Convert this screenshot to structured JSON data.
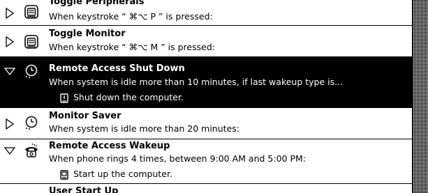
{
  "items": [
    {
      "title": "Toggle Peripherals",
      "condition": "When keystroke “ ⌘⌥ P ” is pressed:",
      "expanded": false,
      "selected": false,
      "icon": "keyboard-icon"
    },
    {
      "title": "Toggle Monitor",
      "condition": "When keystroke “ ⌘⌥ M ” is pressed:",
      "expanded": false,
      "selected": false,
      "icon": "keyboard-icon"
    },
    {
      "title": "Remote Access Shut Down",
      "condition": "When system is idle more than 10 minutes, if last wakeup type is...",
      "expanded": true,
      "selected": true,
      "icon": "sleeping-clock-icon",
      "action": {
        "text": "Shut down the computer.",
        "icon": "shutdown-icon"
      }
    },
    {
      "title": "Monitor Saver",
      "condition": "When system is idle more than 20 minutes:",
      "expanded": false,
      "selected": false,
      "icon": "sleeping-clock-icon"
    },
    {
      "title": "Remote Access Wakeup",
      "condition": "When phone rings 4 times, between 9:00 AM and 5:00 PM:",
      "expanded": true,
      "selected": false,
      "icon": "telephone-icon",
      "action": {
        "text": "Start up the computer.",
        "icon": "startup-icon"
      }
    },
    {
      "title": "User Start Up",
      "expanded": false,
      "selected": false
    }
  ]
}
